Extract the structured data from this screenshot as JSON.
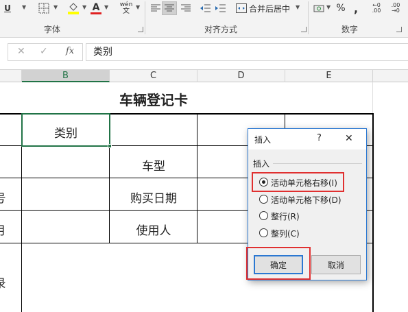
{
  "ribbon": {
    "underline_label": "U",
    "pinyin_top": "wén",
    "pinyin_bottom": "文",
    "font_color_letter": "A",
    "merge_label": "合并后居中",
    "percent_label": "%",
    "comma_label": ",",
    "inc_decimal_top": "←0",
    "inc_decimal_bottom": ".00",
    "dec_decimal_top": ".00",
    "dec_decimal_bottom": "→0",
    "groups": {
      "font": "字体",
      "alignment": "对齐方式",
      "number": "数字"
    },
    "colors": {
      "fill": "#ffff00",
      "font": "#e02020"
    }
  },
  "formula_bar": {
    "cancel_glyph": "✕",
    "enter_glyph": "✓",
    "fx_label": "fx",
    "content": "类别"
  },
  "columns": [
    "B",
    "C",
    "D",
    "E"
  ],
  "active_column": "B",
  "sheet": {
    "title": "车辆登记卡",
    "cells": {
      "b_row1": "类别",
      "c_row2": "车型",
      "a_row3": "号",
      "c_row3": "购买日期",
      "a_row4": "月",
      "c_row4": "使用人",
      "a_row5": "录"
    }
  },
  "dialog": {
    "title": "插入",
    "help": "?",
    "close": "✕",
    "section_label": "插入",
    "options": [
      {
        "label": "活动单元格右移(I)",
        "selected": true
      },
      {
        "label": "活动单元格下移(D)",
        "selected": false
      },
      {
        "label": "整行(R)",
        "selected": false
      },
      {
        "label": "整列(C)",
        "selected": false
      }
    ],
    "ok_label": "确定",
    "cancel_label": "取消",
    "highlight_color": "#e03030"
  }
}
